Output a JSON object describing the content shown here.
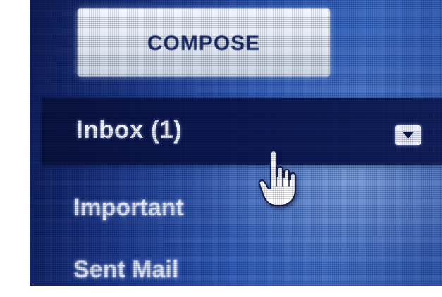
{
  "sidebar": {
    "compose": {
      "label": "COMPOSE"
    },
    "items": [
      {
        "label": "Inbox (1)",
        "selected": true,
        "icon": "chevron-down-icon"
      },
      {
        "label": "Important",
        "selected": false
      },
      {
        "label": "Sent Mail",
        "selected": false
      }
    ]
  },
  "cursor": {
    "icon": "hand-pointer-icon"
  },
  "colors": {
    "screen_background": "#2d5bb8",
    "selected_row": "#0c1850",
    "compose_button": "#e1e8f1",
    "compose_text": "#1a2b66",
    "nav_text": "#e6eeff"
  }
}
